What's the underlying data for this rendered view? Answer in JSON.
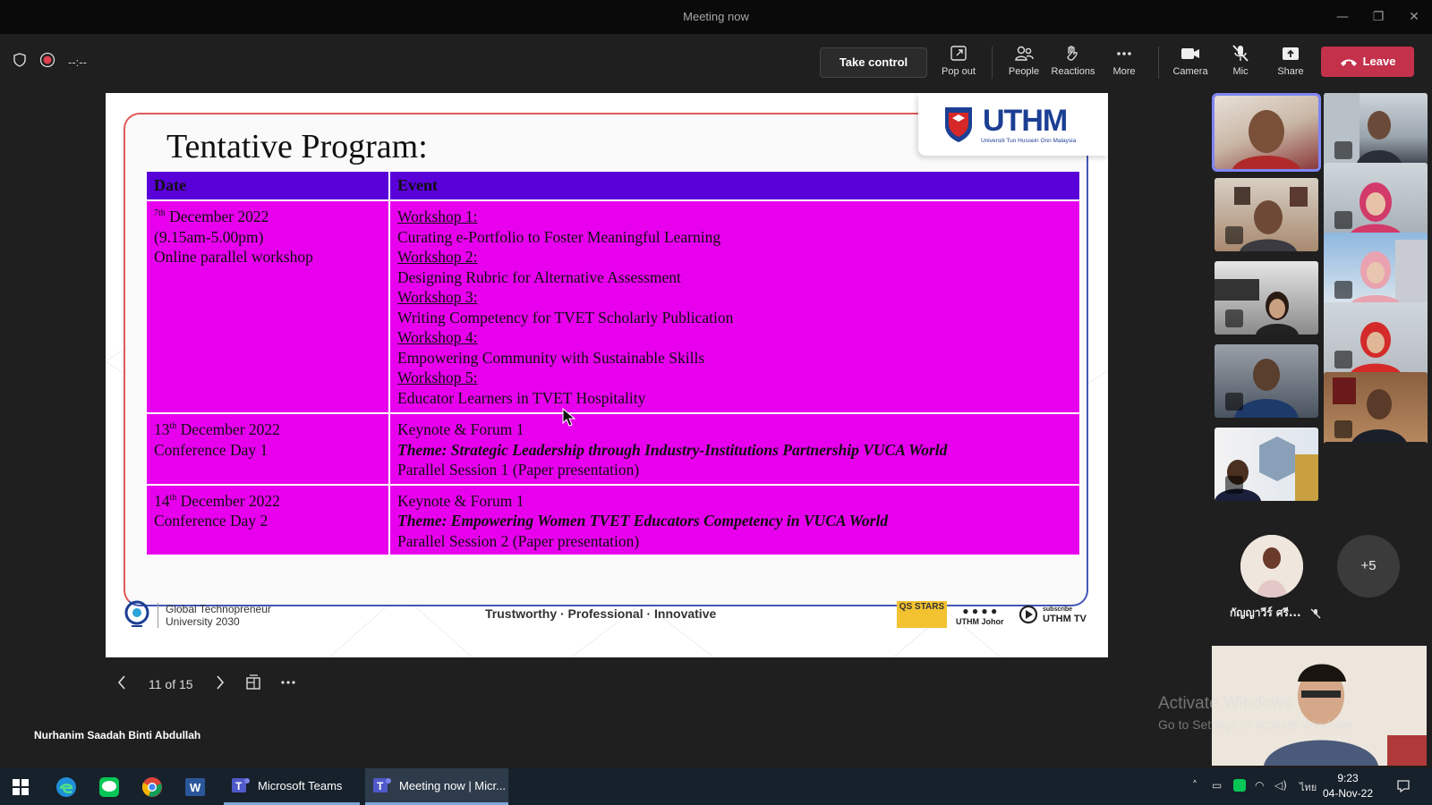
{
  "window": {
    "title": "Meeting now",
    "min_glyph": "—",
    "max_glyph": "❐",
    "close_glyph": "✕"
  },
  "toolbar": {
    "timer": "--:--",
    "take_control": "Take control",
    "buttons": [
      {
        "label": "Pop out",
        "icon": "pop-out-icon"
      },
      {
        "label": "People",
        "icon": "people-icon"
      },
      {
        "label": "Reactions",
        "icon": "reactions-icon"
      },
      {
        "label": "More",
        "icon": "more-icon"
      },
      {
        "label": "Camera",
        "icon": "camera-icon"
      },
      {
        "label": "Mic",
        "icon": "mic-muted-icon"
      },
      {
        "label": "Share",
        "icon": "share-icon"
      }
    ],
    "leave": "Leave",
    "leave_color": "#c4314b"
  },
  "slide": {
    "title": "Tentative Program:",
    "logo_text": "UTHM",
    "logo_sub": "Universiti Tun Hussein Onn Malaysia",
    "table": {
      "headers": [
        "Date",
        "Event"
      ],
      "header_color": "#5a00d8",
      "cell_color": "#e800ee",
      "row1": {
        "date_sup": "7th",
        "date_rest": " December 2022",
        "time": "(9.15am-5.00pm)",
        "mode": "Online parallel workshop",
        "w1": "Workshop 1:",
        "w1t": "Curating e-Portfolio to Foster Meaningful Learning",
        "w2": "Workshop 2:",
        "w2t": "Designing Rubric for Alternative Assessment",
        "w3": "Workshop 3:",
        "w3t": "Writing Competency for TVET Scholarly Publication",
        "w4": "Workshop 4:",
        "w4t": "Empowering Community with Sustainable Skills",
        "w5": "Workshop 5:",
        "w5t": "Educator Learners in TVET Hospitality"
      },
      "row2": {
        "day": "13",
        "sup": "th",
        "date_rest": " December 2022",
        "label": "Conference Day 1",
        "keynote": "Keynote & Forum 1",
        "theme": "Theme: Strategic Leadership through Industry-Institutions Partnership VUCA World",
        "session": "Parallel Session 1 (Paper presentation)"
      },
      "row3": {
        "day": "14",
        "sup": "th",
        "date_rest": " December 2022",
        "label": "Conference Day 2",
        "keynote": "Keynote & Forum 1",
        "theme": "Theme: Empowering Women TVET Educators Competency in VUCA World",
        "session": "Parallel Session 2 (Paper presentation)"
      }
    },
    "footer": {
      "gtu_line1": "Global Technopreneur",
      "gtu_line2": "University 2030",
      "tagline": "Trustworthy · Professional · Innovative",
      "stars": "QS STARS",
      "social": "UTHM Johor",
      "tv_sub": "subscribe",
      "tv": "UTHM TV"
    }
  },
  "presentation_nav": {
    "page": "11 of 15"
  },
  "presenter_name": "Nurhanim Saadah Binti Abdullah",
  "participants": {
    "avatar_name": "กัญญาวีร์ ศรี...",
    "overflow": "+5"
  },
  "watermark": {
    "line1": "Activate Windows",
    "line2": "Go to Settings to activate Windows."
  },
  "taskbar": {
    "apps": [
      {
        "label": "Microsoft Teams"
      },
      {
        "label": "Meeting now | Micr..."
      }
    ],
    "lang": "ไทย",
    "time": "9:23",
    "date": "04-Nov-22"
  }
}
